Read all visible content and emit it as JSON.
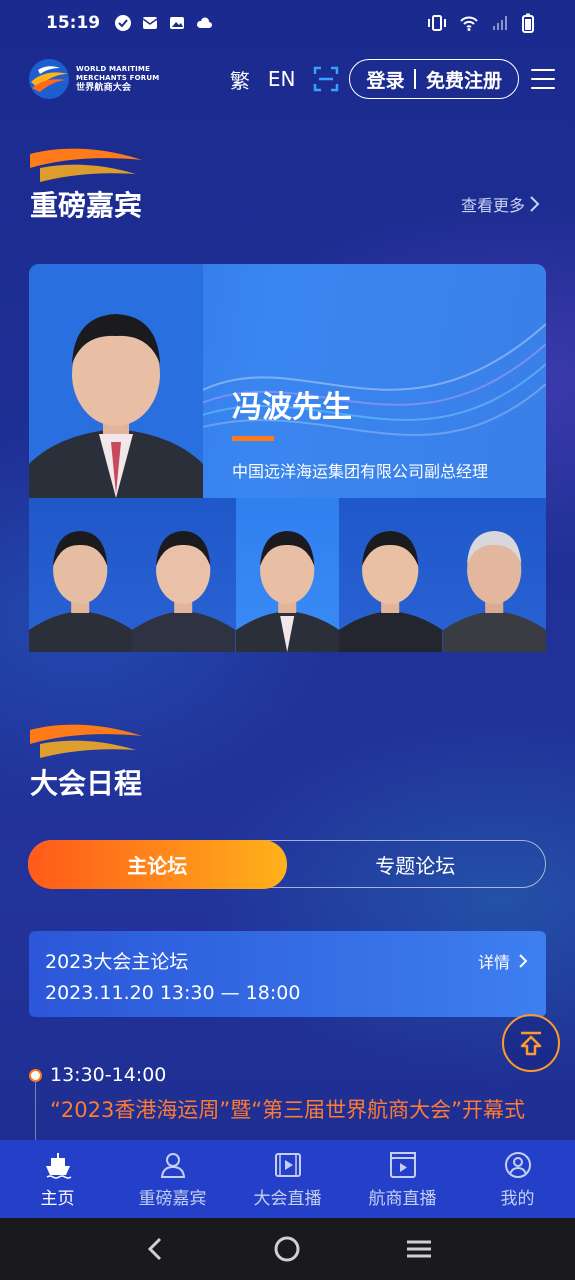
{
  "status": {
    "time": "15:19"
  },
  "header": {
    "logo_en1": "WORLD MARITIME",
    "logo_en2": "MERCHANTS FORUM",
    "logo_cn": "世界航商大会",
    "lang_trad": "繁",
    "lang_en": "EN",
    "login": "登录",
    "register": "免费注册"
  },
  "guests": {
    "title": "重磅嘉宾",
    "more": "查看更多",
    "featured": {
      "name": "冯波先生",
      "position": "中国远洋海运集团有限公司副总经理"
    },
    "thumb_count": 5,
    "active_index": 2
  },
  "schedule": {
    "title": "大会日程",
    "tabs": [
      "主论坛",
      "专题论坛"
    ],
    "active_tab": 0,
    "session": {
      "title": "2023大会主论坛",
      "datetime": "2023.11.20 13:30 — 18:00",
      "detail": "详情"
    },
    "item": {
      "time": "13:30-14:00",
      "title": "“2023香港海运周”暨“第三届世界航商大会”开幕式"
    }
  },
  "bottom_nav": [
    {
      "label": "主页",
      "icon": "ship-icon",
      "active": true
    },
    {
      "label": "重磅嘉宾",
      "icon": "person-icon",
      "active": false
    },
    {
      "label": "大会直播",
      "icon": "video-icon",
      "active": false
    },
    {
      "label": "航商直播",
      "icon": "clapper-icon",
      "active": false
    },
    {
      "label": "我的",
      "icon": "user-icon",
      "active": false
    }
  ],
  "colors": {
    "accent": "#ff7a18",
    "background": "#1f3096",
    "nav": "#2440c8"
  }
}
